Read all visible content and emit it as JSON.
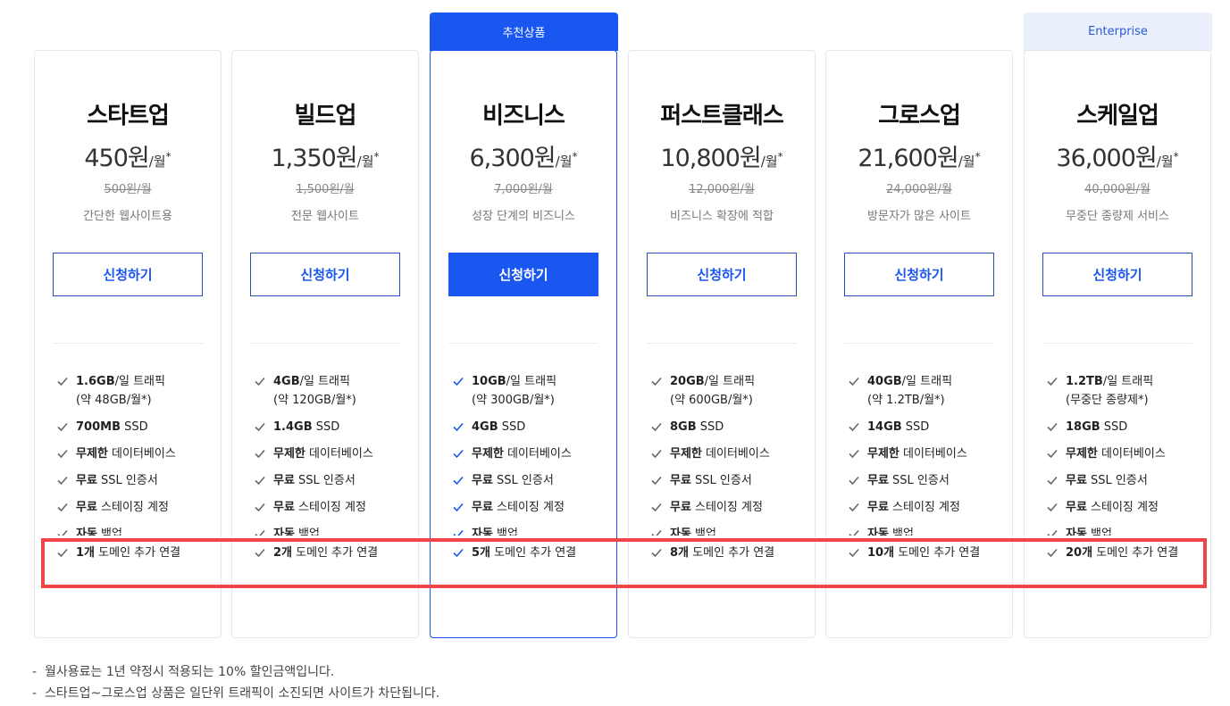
{
  "ribbons": {
    "recommended": "추천상품",
    "enterprise": "Enterprise"
  },
  "common": {
    "apply_label": "신청하기",
    "unit": "/월",
    "star": "*"
  },
  "feature_words": {
    "traffic_suffix": "/일 트래픽",
    "ssd_suffix": " SSD",
    "db_bold": "무제한",
    "db_rest": " 데이터베이스",
    "ssl_bold": "무료",
    "ssl_rest": " SSL 인증서",
    "staging_bold": "무료",
    "staging_rest": " 스테이징 계정",
    "backup_bold": "자동",
    "backup_rest": " 백업",
    "domain_rest": " 도메인 추가 연결"
  },
  "plans": [
    {
      "name": "스타트업",
      "price": "450원",
      "old_price": "500원/월",
      "desc": "간단한 웹사이트용",
      "traffic": "1.6GB",
      "traffic_sub": "(약 48GB/월*)",
      "ssd": "700MB",
      "domains": "1개"
    },
    {
      "name": "빌드업",
      "price": "1,350원",
      "old_price": "1,500원/월",
      "desc": "전문 웹사이트",
      "traffic": "4GB",
      "traffic_sub": "(약 120GB/월*)",
      "ssd": "1.4GB",
      "domains": "2개"
    },
    {
      "name": "비즈니스",
      "price": "6,300원",
      "old_price": "7,000원/월",
      "desc": "성장 단계의 비즈니스",
      "traffic": "10GB",
      "traffic_sub": "(약 300GB/월*)",
      "ssd": "4GB",
      "domains": "5개"
    },
    {
      "name": "퍼스트클래스",
      "price": "10,800원",
      "old_price": "12,000원/월",
      "desc": "비즈니스 확장에 적합",
      "traffic": "20GB",
      "traffic_sub": "(약 600GB/월*)",
      "ssd": "8GB",
      "domains": "8개"
    },
    {
      "name": "그로스업",
      "price": "21,600원",
      "old_price": "24,000원/월",
      "desc": "방문자가 많은 사이트",
      "traffic": "40GB",
      "traffic_sub": "(약 1.2TB/월*)",
      "ssd": "14GB",
      "domains": "10개"
    },
    {
      "name": "스케일업",
      "price": "36,000원",
      "old_price": "40,000원/월",
      "desc": "무중단 종량제 서비스",
      "traffic": "1.2TB",
      "traffic_sub": "(무중단 종량제*)",
      "ssd": "18GB",
      "domains": "20개"
    }
  ],
  "notes": [
    "월사용료는 1년 약정시 적용되는 10% 할인금액입니다.",
    "스타트업~그로스업 상품은 일단위 트래픽이 소진되면 사이트가 차단됩니다."
  ],
  "note_dash": "-",
  "colors": {
    "accent": "#1a56f0",
    "highlight": "#f0464a",
    "check_default": "#666666"
  }
}
